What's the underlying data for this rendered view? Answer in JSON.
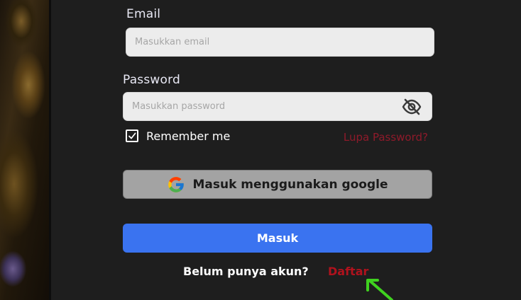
{
  "colors": {
    "background": "#1e1e1e",
    "input_bg": "#ececec",
    "primary_button": "#3a73f0",
    "google_button": "#a3a3a3",
    "danger_link": "#b0121d",
    "annotation_arrow": "#3fd11f"
  },
  "login": {
    "email_label": "Email",
    "email_placeholder": "Masukkan email",
    "password_label": "Password",
    "password_placeholder": "Masukkan password",
    "remember_checked": true,
    "remember_label": "Remember me",
    "forgot_label": "Lupa Password?",
    "google_label": "Masuk menggunakan google",
    "submit_label": "Masuk",
    "no_account_label": "Belum punya akun?",
    "register_label": "Daftar"
  },
  "icons": {
    "password_toggle": "eye-off-icon",
    "google": "google-icon",
    "check": "check-icon",
    "annotation": "arrow-icon"
  }
}
